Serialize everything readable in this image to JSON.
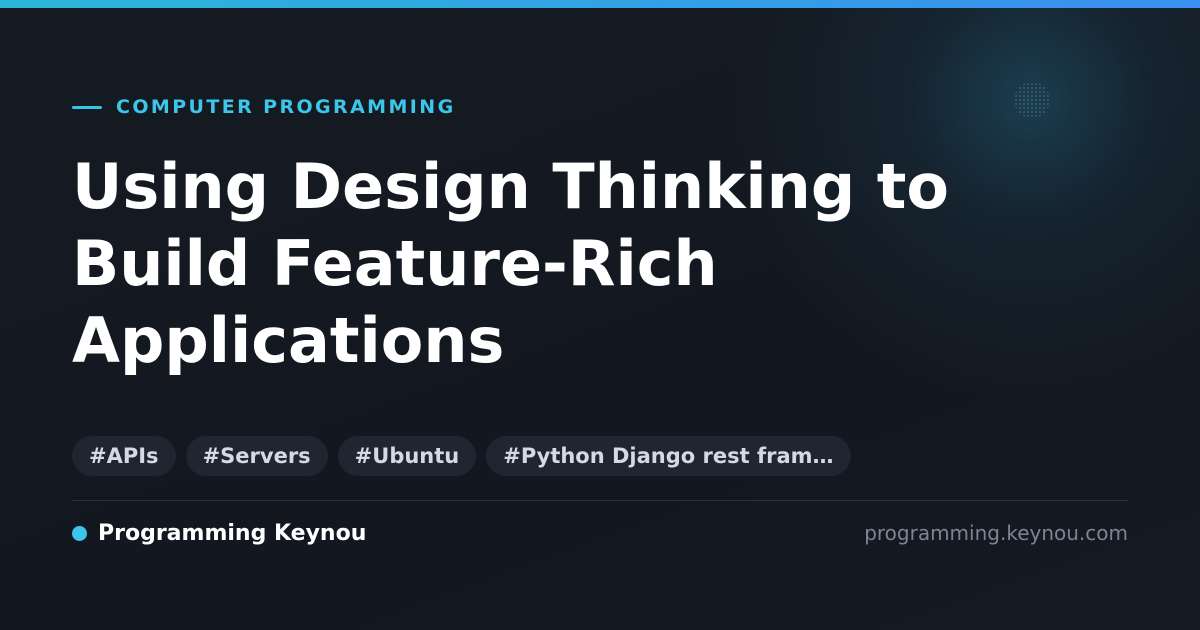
{
  "category": {
    "label": "COMPUTER PROGRAMMING"
  },
  "article": {
    "title": "Using Design Thinking to Build Feature-Rich Applications"
  },
  "tags": [
    "#APIs",
    "#Servers",
    "#Ubuntu",
    "#Python Django rest fram…"
  ],
  "footer": {
    "brand_name": "Programming Keynou",
    "site_url": "programming.keynou.com"
  },
  "colors": {
    "accent": "#3cc6ea",
    "background": "#141820",
    "tag_background": "#1f2632",
    "top_bar_gradient": [
      "#2bb6d9",
      "#3a8ff0"
    ]
  }
}
